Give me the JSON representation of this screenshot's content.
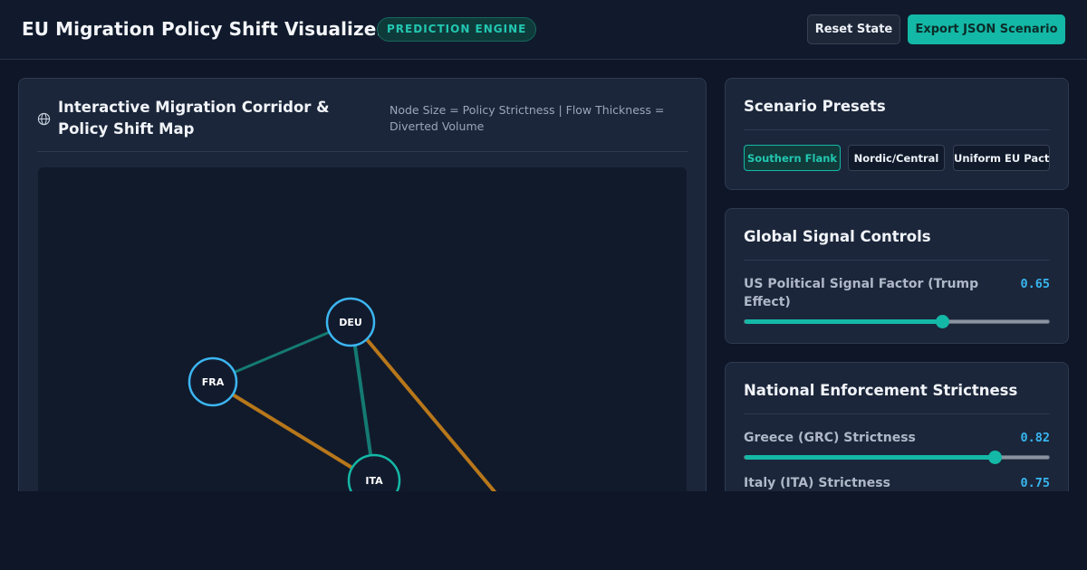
{
  "header": {
    "title": "EU Migration Policy Shift Visualizer",
    "badge": "PREDICTION ENGINE",
    "reset_label": "Reset State",
    "export_label": "Export JSON Scenario"
  },
  "map": {
    "title": "Interactive Migration Corridor & Policy Shift Map",
    "legend": "Node Size = Policy Strictness | Flow Thickness = Diverted Volume",
    "nodes": [
      {
        "id": "DEU",
        "label": "DEU"
      },
      {
        "id": "FRA",
        "label": "FRA"
      },
      {
        "id": "ITA",
        "label": "ITA"
      }
    ]
  },
  "presets": {
    "title": "Scenario Presets",
    "items": [
      {
        "label": "Southern Flank",
        "active": true
      },
      {
        "label": "Nordic/Central",
        "active": false
      },
      {
        "label": "Uniform EU Pact",
        "active": false
      }
    ]
  },
  "global_controls": {
    "title": "Global Signal Controls",
    "us_signal": {
      "label": "US Political Signal Factor (Trump Effect)",
      "value": "0.65",
      "fraction": 0.65
    }
  },
  "national": {
    "title": "National Enforcement Strictness",
    "greece": {
      "label": "Greece (GRC) Strictness",
      "value": "0.82",
      "fraction": 0.82
    },
    "italy": {
      "label": "Italy (ITA) Strictness",
      "value": "0.75",
      "fraction": 0.75
    }
  },
  "colors": {
    "accent": "#14b8a6",
    "value": "#38b6f0",
    "flow_diverted": "#b7771a",
    "flow_normal": "#147a72",
    "node_blue": "#3cb6f2",
    "node_teal": "#14b8a6"
  }
}
